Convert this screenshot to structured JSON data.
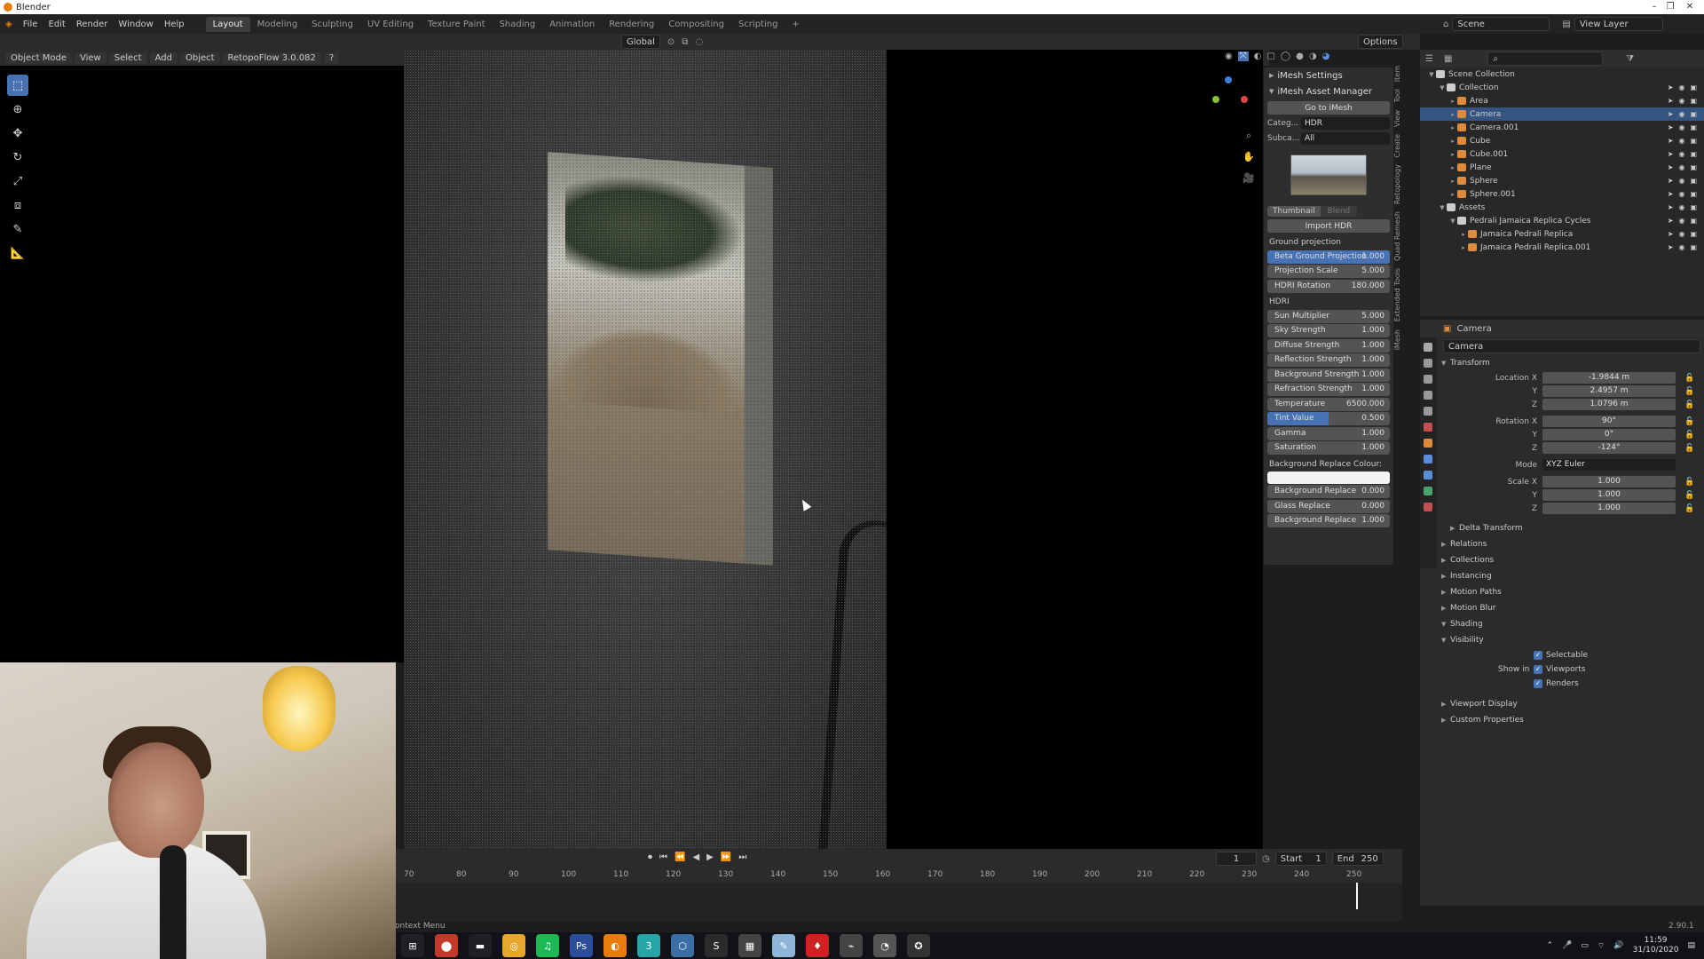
{
  "window": {
    "title": "Blender",
    "controls": [
      "–",
      "❐",
      "✕"
    ]
  },
  "menu": {
    "items": [
      "File",
      "Edit",
      "Render",
      "Window",
      "Help"
    ],
    "workspaces": [
      "Layout",
      "Modeling",
      "Sculpting",
      "UV Editing",
      "Texture Paint",
      "Shading",
      "Animation",
      "Rendering",
      "Compositing",
      "Scripting"
    ],
    "active_workspace": "Layout",
    "add_tab": "+",
    "scene": "Scene",
    "view_layer": "View Layer"
  },
  "viewport_header": {
    "mode": "Object Mode",
    "menus": [
      "View",
      "Select",
      "Add",
      "Object"
    ],
    "addon": "RetopoFlow 3.0.082",
    "transform": "Global",
    "options": "Options"
  },
  "imesh": {
    "settings_title": "iMesh Settings",
    "manager_title": "iMesh Asset Manager",
    "go_button": "Go to iMesh",
    "category_label": "Categ...",
    "category_value": "HDR",
    "subcategory_label": "Subca...",
    "subcategory_value": "All",
    "thumbnail_tab": "Thumbnail",
    "blend_tab": "Blend",
    "import_button": "Import HDR",
    "ground_section": "Ground projection",
    "ground_sliders": [
      {
        "label": "Beta Ground Projection",
        "value": "1.000",
        "fill": 1.0
      },
      {
        "label": "Projection Scale",
        "value": "5.000",
        "fill": 0
      },
      {
        "label": "HDRI Rotation",
        "value": "180.000",
        "fill": 0
      }
    ],
    "hdri_section": "HDRI",
    "hdri_sliders": [
      {
        "label": "Sun Multiplier",
        "value": "5.000",
        "fill": 0
      },
      {
        "label": "Sky Strength",
        "value": "1.000",
        "fill": 0
      },
      {
        "label": "Diffuse Strength",
        "value": "1.000",
        "fill": 0
      },
      {
        "label": "Reflection Strength",
        "value": "1.000",
        "fill": 0
      },
      {
        "label": "Background Strength",
        "value": "1.000",
        "fill": 0
      },
      {
        "label": "Refraction Strength",
        "value": "1.000",
        "fill": 0
      },
      {
        "label": "Temperature",
        "value": "6500.000",
        "fill": 0
      },
      {
        "label": "Tint Value",
        "value": "0.500",
        "fill": 0.5
      },
      {
        "label": "Gamma",
        "value": "1.000",
        "fill": 0
      },
      {
        "label": "Saturation",
        "value": "1.000",
        "fill": 0
      }
    ],
    "bg_colour_label": "Background Replace Colour:",
    "bottom_sliders": [
      {
        "label": "Background Replace",
        "value": "0.000",
        "fill": 0
      },
      {
        "label": "Glass Replace",
        "value": "0.000",
        "fill": 0
      },
      {
        "label": "Background Replace",
        "value": "1.000",
        "fill": 0
      }
    ]
  },
  "sidetabs": [
    "Item",
    "Tool",
    "View",
    "Create",
    "Retopology",
    "Quad Remesh",
    "Extended Tools",
    "iMesh"
  ],
  "outliner": {
    "rows": [
      {
        "name": "Scene Collection",
        "depth": 0,
        "icon": "#cccccc",
        "highlight": false
      },
      {
        "name": "Collection",
        "depth": 1,
        "icon": "#cccccc",
        "highlight": false
      },
      {
        "name": "Area",
        "depth": 2,
        "icon": "#e08a3c",
        "highlight": false
      },
      {
        "name": "Camera",
        "depth": 2,
        "icon": "#e08a3c",
        "highlight": true
      },
      {
        "name": "Camera.001",
        "depth": 2,
        "icon": "#e08a3c",
        "highlight": false
      },
      {
        "name": "Cube",
        "depth": 2,
        "icon": "#e08a3c",
        "highlight": false
      },
      {
        "name": "Cube.001",
        "depth": 2,
        "icon": "#e08a3c",
        "highlight": false
      },
      {
        "name": "Plane",
        "depth": 2,
        "icon": "#e08a3c",
        "highlight": false
      },
      {
        "name": "Sphere",
        "depth": 2,
        "icon": "#e08a3c",
        "highlight": false
      },
      {
        "name": "Sphere.001",
        "depth": 2,
        "icon": "#e08a3c",
        "highlight": false
      },
      {
        "name": "Assets",
        "depth": 1,
        "icon": "#cccccc",
        "highlight": false
      },
      {
        "name": "Pedrali Jamaica Replica Cycles",
        "depth": 2,
        "icon": "#cccccc",
        "highlight": false
      },
      {
        "name": "Jamaica Pedrali Replica",
        "depth": 3,
        "icon": "#e08a3c",
        "highlight": false
      },
      {
        "name": "Jamaica Pedrali Replica.001",
        "depth": 3,
        "icon": "#e08a3c",
        "highlight": false
      }
    ]
  },
  "properties": {
    "object_name": "Camera",
    "datablock": "Camera",
    "transform_title": "Transform",
    "location": [
      {
        "label": "Location X",
        "value": "-1.9844 m"
      },
      {
        "label": "Y",
        "value": "2.4957 m"
      },
      {
        "label": "Z",
        "value": "1.0796 m"
      }
    ],
    "rotation": [
      {
        "label": "Rotation X",
        "value": "90°"
      },
      {
        "label": "Y",
        "value": "0°"
      },
      {
        "label": "Z",
        "value": "-124°"
      }
    ],
    "mode_label": "Mode",
    "mode_value": "XYZ Euler",
    "scale": [
      {
        "label": "Scale X",
        "value": "1.000"
      },
      {
        "label": "Y",
        "value": "1.000"
      },
      {
        "label": "Z",
        "value": "1.000"
      }
    ],
    "delta": "Delta Transform",
    "sections": [
      "Relations",
      "Collections",
      "Instancing",
      "Motion Paths",
      "Motion Blur",
      "Shading",
      "Visibility"
    ],
    "selectable": "Selectable",
    "show_in": "Show in",
    "viewports": "Viewports",
    "renders": "Renders",
    "tail_sections": [
      "Viewport Display",
      "Custom Properties"
    ]
  },
  "timeline": {
    "current_frame": "1",
    "start_label": "Start",
    "start": "1",
    "end_label": "End",
    "end": "250",
    "ticks": [
      "70",
      "80",
      "90",
      "100",
      "110",
      "120",
      "130",
      "140",
      "150",
      "160",
      "170",
      "180",
      "190",
      "200",
      "210",
      "220",
      "230",
      "240",
      "250"
    ]
  },
  "status": {
    "text": "ontext Menu",
    "version": "2.90.1"
  },
  "taskbar": {
    "apps": [
      "⊞",
      "⬤",
      "▬",
      "◎",
      "♫",
      "Ps",
      "◐",
      "3",
      "⬡",
      "S",
      "▦",
      "✎",
      "♦",
      "⌁",
      "◔",
      "✪"
    ],
    "time": "11:59",
    "date": "31/10/2020"
  }
}
